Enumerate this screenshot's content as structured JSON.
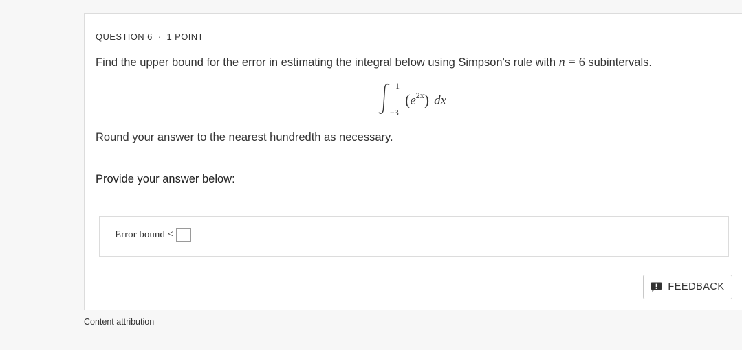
{
  "question": {
    "number_label": "QUESTION 6",
    "separator": "·",
    "points_label": "1 POINT",
    "prompt_before": "Find the upper bound for the error in estimating the integral below using Simpson's rule with",
    "prompt_var": "n",
    "prompt_eq": "=",
    "prompt_num": "6",
    "prompt_after": "subintervals.",
    "integral": {
      "sign": "∫",
      "upper_limit": "1",
      "lower_limit": "−3",
      "left_paren": "(",
      "base": "e",
      "exponent": "2x",
      "right_paren": ")",
      "differential": "dx"
    },
    "round_note": "Round your answer to the nearest hundredth as necessary."
  },
  "answer_section": {
    "heading": "Provide your answer below:",
    "label": "Error bound",
    "relation": "≤",
    "input_value": ""
  },
  "feedback_button": {
    "label": "FEEDBACK",
    "icon": "feedback-icon"
  },
  "attribution": {
    "label": "Content attribution"
  }
}
